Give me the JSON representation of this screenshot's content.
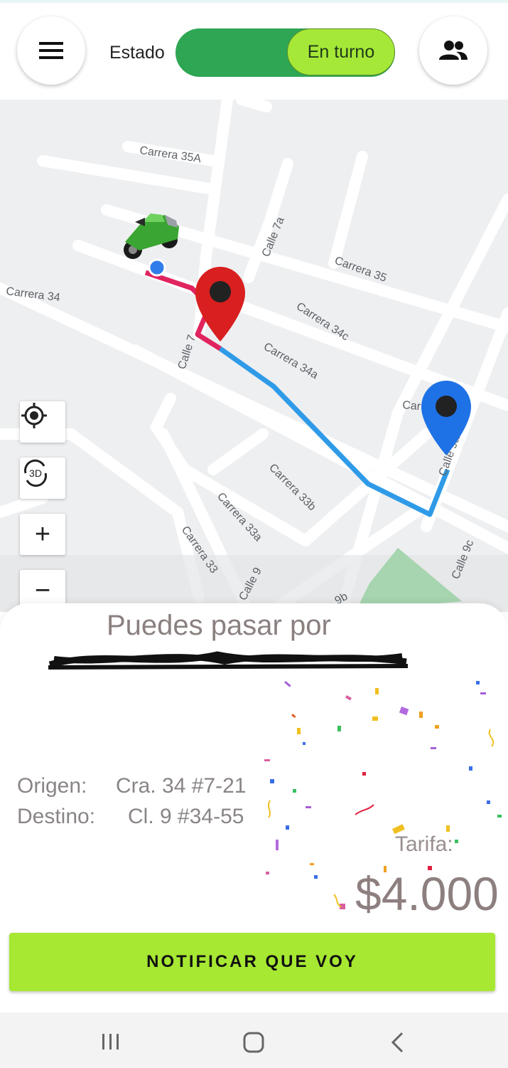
{
  "header": {
    "estado_label": "Estado",
    "toggle_label": "En turno",
    "menu_icon": "hamburger-menu-icon",
    "users_icon": "people-icon"
  },
  "map": {
    "streets": [
      "Carrera 35A",
      "Calle 7a",
      "Carrera 35",
      "Carrera 34",
      "Carrera 34c",
      "Calle 7",
      "Carrera 34a",
      "Carrera 33b",
      "Carrera 33a",
      "Carrera 33",
      "Calle 9",
      "Calle 9a",
      "Calle 9c",
      "Car",
      "9b"
    ],
    "controls": {
      "locate_icon": "crosshair-icon",
      "three_d_label": "3D",
      "zoom_in_label": "+",
      "zoom_out_label": "−"
    },
    "colors": {
      "route_origin": "#e0245e",
      "route_main": "#2f9be8",
      "origin_pin": "#d91f1f",
      "destination_pin": "#1e72e6"
    }
  },
  "sheet": {
    "title": "Puedes pasar por",
    "origen_label": "Origen:",
    "origen_value": "Cra. 34 #7-21",
    "destino_label": "Destino:",
    "destino_value": "Cl. 9 #34-55",
    "tarifa_label": "Tarifa:",
    "tarifa_value": "$4.000",
    "action_button": "NOTIFICAR QUE VOY"
  },
  "navbar": {
    "recent_icon": "recent-apps-icon",
    "home_icon": "home-icon",
    "back_icon": "back-icon"
  }
}
